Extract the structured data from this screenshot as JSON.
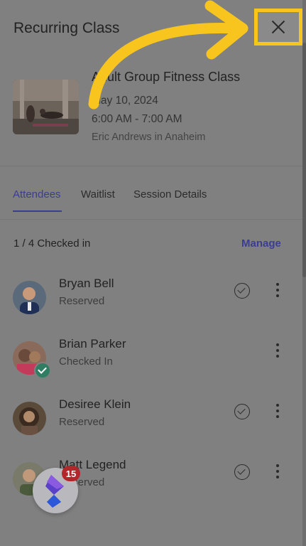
{
  "header": {
    "title": "Recurring Class"
  },
  "session": {
    "name": "Adult Group Fitness Class",
    "date": "May 10, 2024",
    "time": "6:00 AM - 7:00 AM",
    "instructor_location": "Eric Andrews in Anaheim"
  },
  "tabs": [
    {
      "label": "Attendees",
      "active": true
    },
    {
      "label": "Waitlist",
      "active": false
    },
    {
      "label": "Session Details",
      "active": false
    }
  ],
  "summary": {
    "checked_in": "1 / 4 Checked in",
    "manage_label": "Manage"
  },
  "attendees": [
    {
      "name": "Bryan Bell",
      "status": "Reserved"
    },
    {
      "name": "Brian Parker",
      "status": "Checked In"
    },
    {
      "name": "Desiree Klein",
      "status": "Reserved"
    },
    {
      "name": "Matt Legend",
      "status": "Reserved"
    }
  ],
  "fab": {
    "badge_count": "15"
  },
  "colors": {
    "accent": "#3b3e8f",
    "highlight": "#f7c51e",
    "checked_in_green": "#2f7d63",
    "badge_red": "#b3262b"
  }
}
